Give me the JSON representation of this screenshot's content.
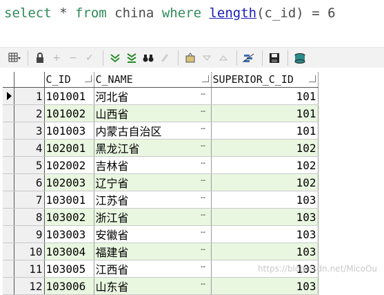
{
  "sql": {
    "kw_select": "select",
    "star": " * ",
    "kw_from": "from",
    "table": " china ",
    "kw_where": "where",
    "fn_length": "length",
    "arg": "(c_id)",
    "op": " = ",
    "value": "6"
  },
  "grid": {
    "headers": [
      "C_ID",
      "C_NAME",
      "SUPERIOR_C_ID"
    ],
    "rows": [
      {
        "n": "1",
        "id": "101001",
        "name": "河北省",
        "sup": "101"
      },
      {
        "n": "2",
        "id": "101002",
        "name": "山西省",
        "sup": "101"
      },
      {
        "n": "3",
        "id": "101003",
        "name": "内蒙古自治区",
        "sup": "101"
      },
      {
        "n": "4",
        "id": "102001",
        "name": "黑龙江省",
        "sup": "102"
      },
      {
        "n": "5",
        "id": "102002",
        "name": "吉林省",
        "sup": "102"
      },
      {
        "n": "6",
        "id": "102003",
        "name": "辽宁省",
        "sup": "102"
      },
      {
        "n": "7",
        "id": "103001",
        "name": "江苏省",
        "sup": "103"
      },
      {
        "n": "8",
        "id": "103002",
        "name": "浙江省",
        "sup": "103"
      },
      {
        "n": "9",
        "id": "103003",
        "name": "安徽省",
        "sup": "103"
      },
      {
        "n": "10",
        "id": "103004",
        "name": "福建省",
        "sup": "103"
      },
      {
        "n": "11",
        "id": "103005",
        "name": "江西省",
        "sup": "103"
      },
      {
        "n": "12",
        "id": "103006",
        "name": "山东省",
        "sup": "103"
      }
    ],
    "ellipsis": "…"
  },
  "toolbar": {
    "icons": [
      "grid-icon",
      "lock-icon",
      "add-icon",
      "remove-icon",
      "check-icon",
      "filter-down-icon",
      "filter-bottom-icon",
      "binoculars-icon",
      "clear-icon",
      "export-icon",
      "down-icon",
      "up-icon",
      "query-icon",
      "save-icon",
      "database-icon"
    ]
  },
  "watermark": "https://blog.csdn.net/MicoOu",
  "colors": {
    "alt_row": "#e9f7e1",
    "keyword": "#2e8b57",
    "function": "#1a1ab8"
  }
}
